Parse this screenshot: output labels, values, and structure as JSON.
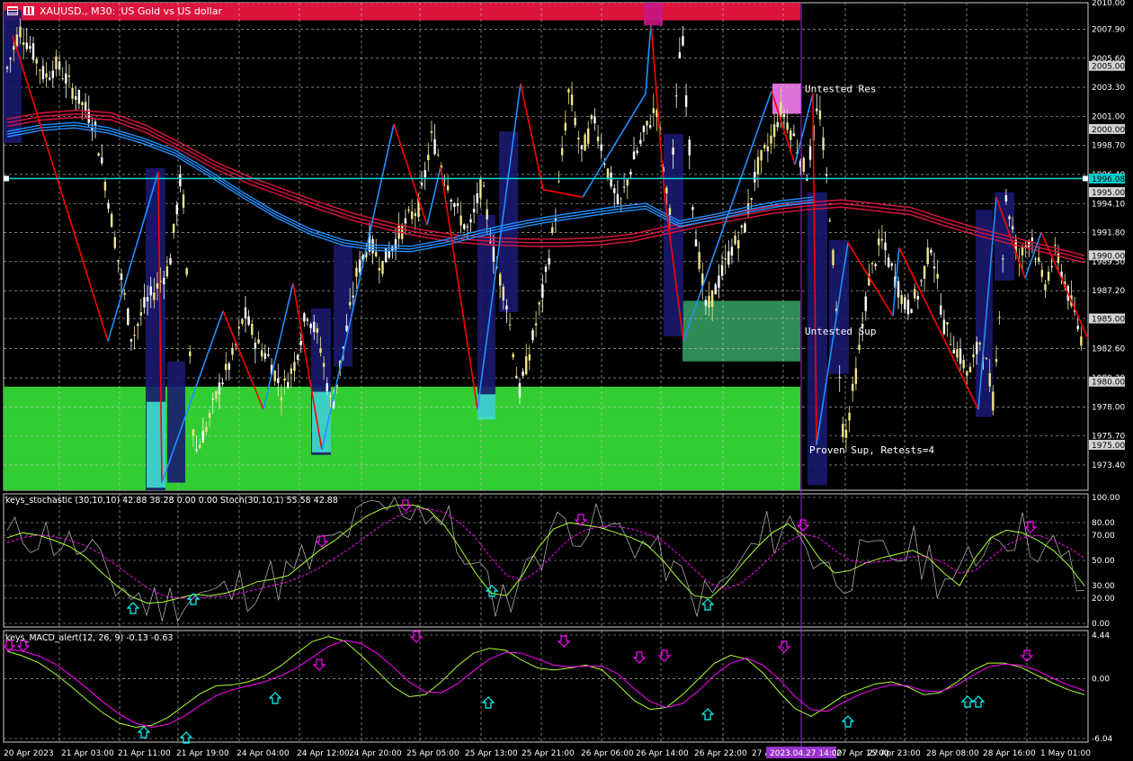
{
  "window": {
    "symbol": "XAUUSD., M30:",
    "description": "US Gold vs US dollar"
  },
  "colors": {
    "background": "#000000",
    "grid": "#c8c8c8",
    "axis_text": "#ffffff",
    "resistance_zone": "#dc143c",
    "support_zone": "#32cd32",
    "untested_res": "#da70d6",
    "untested_sup": "#2e8b57",
    "bar_highlight": "#191970",
    "cyan_hline": "#00ced1",
    "ma_red": "#dc143c",
    "ma_blue": "#1e90ff",
    "zigzag_up": "#1e90ff",
    "zigzag_down": "#ff0000",
    "stoch_main": "#adff2f",
    "stoch_signal": "#ff00ff",
    "arrow_down": "#ff00ff",
    "arrow_up": "#00ffff",
    "crosshair": "#9932cc"
  },
  "main_chart": {
    "price_ticks": [
      "2010.00",
      "2007.90",
      "2005.60",
      "2003.30",
      "2001.00",
      "1998.70",
      "1996.40",
      "1994.10",
      "1991.80",
      "1989.50",
      "1987.20",
      "1985.00",
      "1982.60",
      "1980.30",
      "1978.00",
      "1975.70",
      "1973.40"
    ],
    "level_labels": [
      "2005.00",
      "2000.00",
      "1995.00",
      "1990.00",
      "1985.00",
      "1980.00",
      "1975.00"
    ],
    "current_price": "1996.08",
    "zone_labels": {
      "untested_res": "Untested Res",
      "untested_sup": "Untested Sup",
      "proven_sup": "Proven Sup, Retests=4"
    }
  },
  "stoch_panel": {
    "title": "keys_stochastic (30,10,10) 42.88 38.28 0.00 0.00 Stoch(30,10,1) 55.58 42.88",
    "ticks": [
      "100.00",
      "80.00",
      "70.00",
      "50.00",
      "30.00",
      "20.00",
      "0.00"
    ]
  },
  "macd_panel": {
    "title": "keys_MACD_alert(12, 26, 9) -0.13 -0.63",
    "ticks": [
      "4.44",
      "0.00",
      "-6.04"
    ]
  },
  "time_axis": {
    "labels": [
      "20 Apr 2023",
      "21 Apr 03:00",
      "21 Apr 11:00",
      "21 Apr 19:00",
      "24 Apr 04:00",
      "24 Apr 12:00",
      "24 Apr 20:00",
      "25 Apr 05:00",
      "25 Apr 13:00",
      "25 Apr 21:00",
      "26 Apr 06:00",
      "26 Apr 14:00",
      "26 Apr 22:00",
      "27 Apr 07:00",
      "27 Apr 15:00",
      "27 Apr 23:00",
      "28 Apr 08:00",
      "28 Apr 16:00",
      "1 May 01:00"
    ],
    "crosshair_label": "2023.04.27 14:00"
  },
  "chart_data": {
    "type": "line",
    "symbol": "XAUUSD.",
    "timeframe": "M30",
    "price_series": [
      2004.8,
      2007.9,
      2006.2,
      2004.1,
      2005.1,
      2003.5,
      2002.0,
      2000.3,
      1995.0,
      1989.0,
      1983.3,
      1986.0,
      1987.5,
      1989.2,
      1996.9,
      1974.2,
      1976.5,
      1979.6,
      1981.8,
      1985.4,
      1983.0,
      1981.8,
      1979.2,
      1981.4,
      1985.6,
      1983.2,
      1977.8,
      1983.1,
      1988.6,
      1991.1,
      1989.2,
      1991.0,
      1992.7,
      1993.9,
      1999.4,
      1996.7,
      1993.5,
      1991.8,
      1995.7,
      1989.8,
      1986.3,
      1979.0,
      1983.0,
      1987.6,
      1993.8,
      2003.2,
      1998.0,
      2001.0,
      1997.0,
      1993.7,
      1997.1,
      1999.6,
      2001.8,
      1993.0,
      2008.4,
      1992.6,
      1985.5,
      1988.0,
      1990.5,
      1992.0,
      1996.8,
      1998.8,
      2001.6,
      1999.3,
      1996.3,
      2002.1,
      1992.1,
      1975.0,
      1980.8,
      1988.1,
      1991.2,
      1988.4,
      1985.7,
      1987.0,
      1991.0,
      1984.5,
      1982.6,
      1980.5,
      1983.5,
      1978.2,
      1994.6,
      1989.6,
      1991.7,
      1987.5,
      1990.3,
      1986.8,
      1983.5
    ],
    "ma_red_series": [
      2000.5,
      2001.0,
      2001.2,
      2001.0,
      2000.0,
      1998.6,
      1997.1,
      1995.9,
      1994.9,
      1993.9,
      1993.0,
      1992.3,
      1991.7,
      1991.3,
      1991.1,
      1991.0,
      1991.0,
      1991.1,
      1991.4,
      1992.0,
      1992.6,
      1993.1,
      1993.6,
      1993.9,
      1994.1,
      1993.8,
      1993.5,
      1992.6,
      1991.8,
      1991.1,
      1990.4,
      1989.7
    ],
    "ma_blue_series": [
      1999.6,
      2000.1,
      2000.3,
      1999.9,
      1999.1,
      1998.1,
      1996.5,
      1994.8,
      1993.2,
      1991.9,
      1991.0,
      1990.6,
      1990.5,
      1991.0,
      1991.7,
      1992.3,
      1992.8,
      1993.2,
      1993.6,
      1993.9,
      1992.5,
      1993.0,
      1993.6,
      1994.1,
      1994.4
    ],
    "zones": [
      {
        "label": "",
        "type": "resistance",
        "from": 2008.6,
        "to": 2010.0
      },
      {
        "label": "Untested Res",
        "type": "resistance",
        "from": 2001.2,
        "to": 2003.6
      },
      {
        "label": "Untested Sup",
        "type": "support",
        "from": 1981.6,
        "to": 1986.4
      },
      {
        "label": "Proven Sup, Retests=4",
        "type": "support",
        "from": 1971.4,
        "to": 1979.6
      }
    ],
    "stochastic_main": [
      68,
      72,
      70,
      66,
      61,
      53,
      41,
      30,
      21,
      16,
      17,
      20,
      23,
      22,
      24,
      28,
      33,
      35,
      38,
      48,
      58,
      66,
      76,
      85,
      91,
      94,
      94,
      90,
      78,
      60,
      40,
      24,
      22,
      38,
      60,
      75,
      80,
      78,
      76,
      72,
      68,
      62,
      50,
      35,
      22,
      20,
      31,
      46,
      60,
      72,
      79,
      70,
      52,
      40,
      42,
      48,
      52,
      55,
      58,
      52,
      40,
      30,
      52,
      68,
      74,
      72,
      66,
      58,
      46,
      30
    ],
    "stochastic_signal": [
      64,
      68,
      70,
      69,
      66,
      62,
      55,
      46,
      37,
      28,
      22,
      20,
      20,
      21,
      22,
      24,
      27,
      30,
      33,
      38,
      44,
      52,
      60,
      69,
      78,
      85,
      90,
      91,
      88,
      80,
      68,
      52,
      38,
      34,
      42,
      55,
      67,
      74,
      77,
      77,
      75,
      71,
      65,
      55,
      43,
      32,
      27,
      32,
      42,
      54,
      65,
      71,
      68,
      58,
      50,
      48,
      49,
      51,
      53,
      53,
      48,
      40,
      42,
      52,
      62,
      68,
      70,
      66,
      60,
      52
    ],
    "macd_main": [
      2.8,
      2.3,
      1.6,
      0.5,
      -0.8,
      -2.2,
      -3.5,
      -4.5,
      -4.9,
      -4.7,
      -3.9,
      -2.7,
      -1.5,
      -0.7,
      -0.6,
      -0.3,
      0.3,
      1.3,
      2.6,
      3.8,
      4.3,
      3.8,
      2.4,
      0.8,
      -0.8,
      -1.8,
      -1.6,
      -0.3,
      1.3,
      2.6,
      3.1,
      2.9,
      1.9,
      1.1,
      0.9,
      1.1,
      1.4,
      0.9,
      -0.6,
      -2.2,
      -3.1,
      -2.9,
      -1.6,
      0.0,
      1.6,
      2.4,
      2.0,
      0.6,
      -1.3,
      -3.0,
      -3.8,
      -2.8,
      -1.7,
      -1.1,
      -0.5,
      -0.3,
      -0.8,
      -1.6,
      -1.4,
      -0.4,
      0.8,
      1.6,
      1.6,
      1.2,
      0.4,
      -0.4,
      -1.1,
      -1.6
    ],
    "macd_signal": [
      3.0,
      2.8,
      2.3,
      1.5,
      0.3,
      -1.0,
      -2.4,
      -3.6,
      -4.5,
      -4.9,
      -4.6,
      -3.8,
      -2.7,
      -1.7,
      -1.1,
      -0.7,
      -0.3,
      0.3,
      1.1,
      2.2,
      3.3,
      3.9,
      3.6,
      2.6,
      1.2,
      -0.3,
      -1.3,
      -1.4,
      -0.5,
      0.8,
      2.0,
      2.7,
      2.6,
      2.0,
      1.4,
      1.2,
      1.3,
      1.3,
      0.5,
      -1.0,
      -2.3,
      -2.9,
      -2.5,
      -1.2,
      0.4,
      1.6,
      2.1,
      1.4,
      0.0,
      -1.8,
      -3.1,
      -3.3,
      -2.4,
      -1.6,
      -1.0,
      -0.6,
      -0.7,
      -1.2,
      -1.3,
      -0.7,
      0.3,
      1.2,
      1.5,
      1.4,
      0.9,
      0.1,
      -0.6,
      -1.2
    ]
  }
}
